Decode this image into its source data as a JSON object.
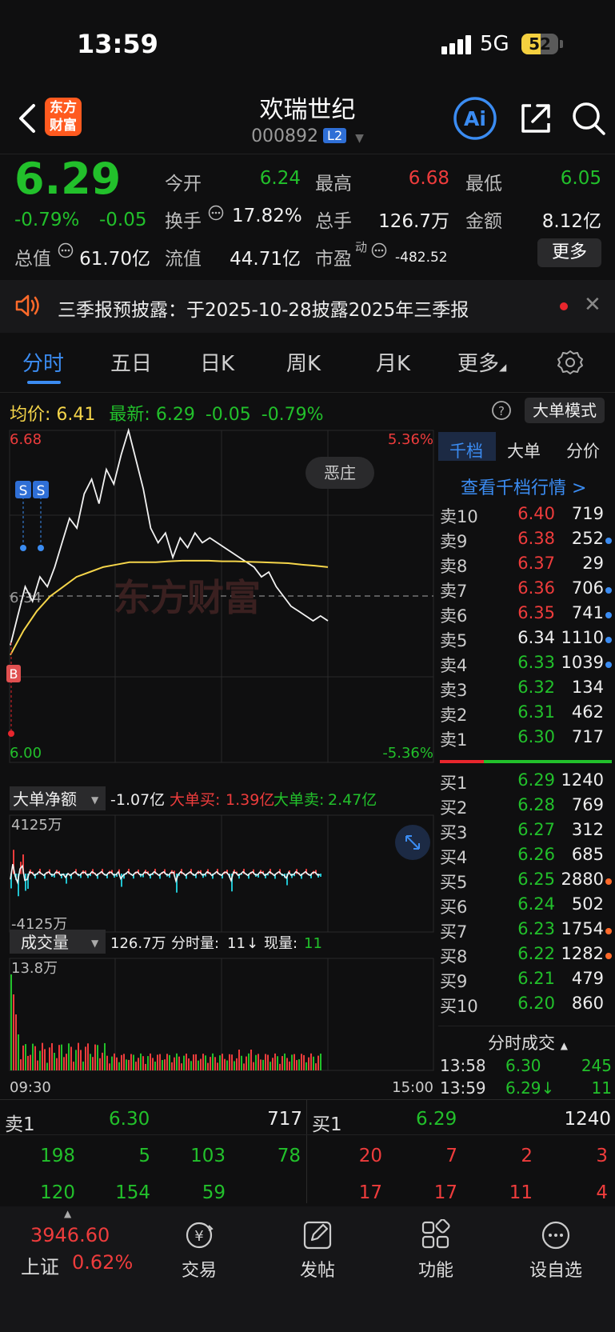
{
  "status": {
    "time": "13:59",
    "network": "5G",
    "battery": "52",
    "battery_level": 0.52
  },
  "header": {
    "name": "欢瑞世纪",
    "code": "000892",
    "level_badge": "L2",
    "logo_text": "东方财富",
    "ai_label": "Ai"
  },
  "quote": {
    "price": "6.29",
    "pct": "-0.79%",
    "chg": "-0.05",
    "open_label": "今开",
    "open": "6.24",
    "high_label": "最高",
    "high": "6.68",
    "low_label": "最低",
    "low": "6.05",
    "turnover_label": "换手",
    "turnover": "17.82%",
    "volume_label": "总手",
    "volume": "126.7万",
    "amount_label": "金额",
    "amount": "8.12亿",
    "mcap_label": "总值",
    "mcap": "61.70亿",
    "float_label": "流值",
    "float": "44.71亿",
    "pe_label": "市盈",
    "pe_sup": "动",
    "pe": "-482.52",
    "more_label": "更多"
  },
  "notice": {
    "text": "三季报预披露：于2025-10-28披露2025年三季报"
  },
  "tabs": [
    "分时",
    "五日",
    "日K",
    "周K",
    "月K",
    "更多"
  ],
  "infoline": {
    "avg_label": "均价:",
    "avg": "6.41",
    "latest_label": "最新:",
    "latest": "6.29",
    "chg": "-0.05",
    "pct": "-0.79%",
    "mode_button": "大单模式"
  },
  "chart_data": {
    "type": "line",
    "price_axis": {
      "top": "6.68",
      "mid": "6.34",
      "bottom": "6.00",
      "top_pct": "5.36%",
      "bottom_pct": "-5.36%"
    },
    "time_axis": {
      "start": "09:30",
      "end": "15:00"
    },
    "watermark": "东方财富",
    "tag": "恶庄",
    "signals": [
      "S",
      "S",
      "B"
    ],
    "series": [
      {
        "values": [
          6.24,
          6.3,
          6.36,
          6.33,
          6.38,
          6.36,
          6.4,
          6.45,
          6.5,
          6.48,
          6.55,
          6.58,
          6.53,
          6.6,
          6.57,
          6.63,
          6.68,
          6.62,
          6.56,
          6.48,
          6.45,
          6.47,
          6.42,
          6.46,
          6.44,
          6.47,
          6.45,
          6.46,
          6.45,
          6.44,
          6.43,
          6.42,
          6.41,
          6.4,
          6.38,
          6.39,
          6.36,
          6.34,
          6.32,
          6.31,
          6.3,
          6.29,
          6.3,
          6.29
        ]
      },
      {
        "values": [
          6.22,
          6.27,
          6.31,
          6.34,
          6.36,
          6.38,
          6.39,
          6.4,
          6.405,
          6.41,
          6.41,
          6.41,
          6.412,
          6.413,
          6.413,
          6.413,
          6.412,
          6.412,
          6.411,
          6.41,
          6.409,
          6.408,
          6.405,
          6.403,
          6.4
        ]
      }
    ],
    "big_order": {
      "label": "大单净额",
      "net": "-1.07亿",
      "buy_label": "大单买:",
      "buy": "1.39亿",
      "sell_label": "大单卖:",
      "sell": "2.47亿",
      "top": "4125万",
      "bottom": "-4125万"
    },
    "volume": {
      "label": "成交量",
      "total": "126.7万",
      "minute_label": "分时量:",
      "minute": "11",
      "arrow": "↓",
      "now_label": "现量:",
      "now": "11",
      "top": "13.8万"
    }
  },
  "book": {
    "tabs": [
      "千档",
      "大单",
      "分价"
    ],
    "link": "查看千档行情 >",
    "asks": [
      {
        "label": "卖10",
        "price": "6.40",
        "vol": "719",
        "color": "#ee3c3c",
        "dot": ""
      },
      {
        "label": "卖9",
        "price": "6.38",
        "vol": "252",
        "color": "#ee3c3c",
        "dot": "#3b8cf2"
      },
      {
        "label": "卖8",
        "price": "6.37",
        "vol": "29",
        "color": "#ee3c3c",
        "dot": ""
      },
      {
        "label": "卖7",
        "price": "6.36",
        "vol": "706",
        "color": "#ee3c3c",
        "dot": "#3b8cf2"
      },
      {
        "label": "卖6",
        "price": "6.35",
        "vol": "741",
        "color": "#ee3c3c",
        "dot": "#3b8cf2"
      },
      {
        "label": "卖5",
        "price": "6.34",
        "vol": "1110",
        "color": "#f0f0f0",
        "dot": "#3b8cf2"
      },
      {
        "label": "卖4",
        "price": "6.33",
        "vol": "1039",
        "color": "#22c02b",
        "dot": "#3b8cf2"
      },
      {
        "label": "卖3",
        "price": "6.32",
        "vol": "134",
        "color": "#22c02b",
        "dot": ""
      },
      {
        "label": "卖2",
        "price": "6.31",
        "vol": "462",
        "color": "#22c02b",
        "dot": ""
      },
      {
        "label": "卖1",
        "price": "6.30",
        "vol": "717",
        "color": "#22c02b",
        "dot": ""
      }
    ],
    "bids": [
      {
        "label": "买1",
        "price": "6.29",
        "vol": "1240",
        "color": "#22c02b",
        "dot": ""
      },
      {
        "label": "买2",
        "price": "6.28",
        "vol": "769",
        "color": "#22c02b",
        "dot": ""
      },
      {
        "label": "买3",
        "price": "6.27",
        "vol": "312",
        "color": "#22c02b",
        "dot": ""
      },
      {
        "label": "买4",
        "price": "6.26",
        "vol": "685",
        "color": "#22c02b",
        "dot": ""
      },
      {
        "label": "买5",
        "price": "6.25",
        "vol": "2880",
        "color": "#22c02b",
        "dot": "#ff6a2a"
      },
      {
        "label": "买6",
        "price": "6.24",
        "vol": "502",
        "color": "#22c02b",
        "dot": ""
      },
      {
        "label": "买7",
        "price": "6.23",
        "vol": "1754",
        "color": "#22c02b",
        "dot": "#ff6a2a"
      },
      {
        "label": "买8",
        "price": "6.22",
        "vol": "1282",
        "color": "#22c02b",
        "dot": "#ff6a2a"
      },
      {
        "label": "买9",
        "price": "6.21",
        "vol": "479",
        "color": "#22c02b",
        "dot": ""
      },
      {
        "label": "买10",
        "price": "6.20",
        "vol": "860",
        "color": "#22c02b",
        "dot": ""
      }
    ],
    "trades_header": "分时成交",
    "trades": [
      {
        "time": "13:58",
        "price": "6.30",
        "vol": "245"
      },
      {
        "time": "13:59",
        "price": "6.29↓",
        "vol": "11"
      }
    ]
  },
  "bottom_book": {
    "ask_label": "卖1",
    "ask_price": "6.30",
    "ask_vol": "717",
    "bid_label": "买1",
    "bid_price": "6.29",
    "bid_vol": "1240",
    "ask_row1": [
      "198",
      "5",
      "103",
      "78"
    ],
    "ask_row2": [
      "120",
      "154",
      "59"
    ],
    "bid_row1": [
      "20",
      "7",
      "2",
      "3"
    ],
    "bid_row2": [
      "17",
      "17",
      "11",
      "4"
    ]
  },
  "nav": {
    "index_value": "3946.60",
    "index_name": "上证",
    "index_pct": "0.62%",
    "items": [
      "交易",
      "发帖",
      "功能",
      "设自选"
    ]
  }
}
